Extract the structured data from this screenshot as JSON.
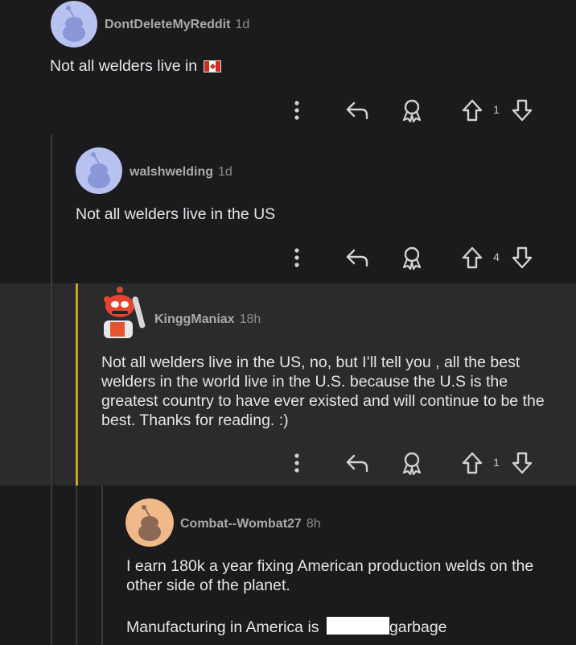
{
  "comments": [
    {
      "username": "DontDeleteMyReddit",
      "age": "1d",
      "text": "Not all welders live in",
      "flag_icon": "canada-flag-icon",
      "votes": "1"
    },
    {
      "username": "walshwelding",
      "age": "1d",
      "text": "Not all welders live in the US",
      "votes": "4"
    },
    {
      "username": "KinggManiax",
      "age": "18h",
      "text": "Not all welders live in the US, no, but I’ll tell you , all the best welders in the world live in the U.S. because the U.S is the greatest country to have ever existed and will continue to be the best. Thanks for reading. :)",
      "votes": "1"
    },
    {
      "username": "Combat--Wombat27",
      "age": "8h",
      "text_line1": "I earn 180k a year fixing American production welds on the other side of the planet.",
      "text_line2_prefix": "Manufacturing in America is",
      "text_line2_suffix": "garbage"
    }
  ],
  "icons": {
    "more": "more-vertical-icon",
    "reply": "reply-icon",
    "award": "award-icon",
    "upvote": "upvote-icon",
    "downvote": "downvote-icon"
  },
  "colors": {
    "background": "#1b1b1d",
    "highlight_background": "#2a2b2d",
    "highlight_bar": "#c9a227",
    "thread_line": "#3a3a3c"
  }
}
